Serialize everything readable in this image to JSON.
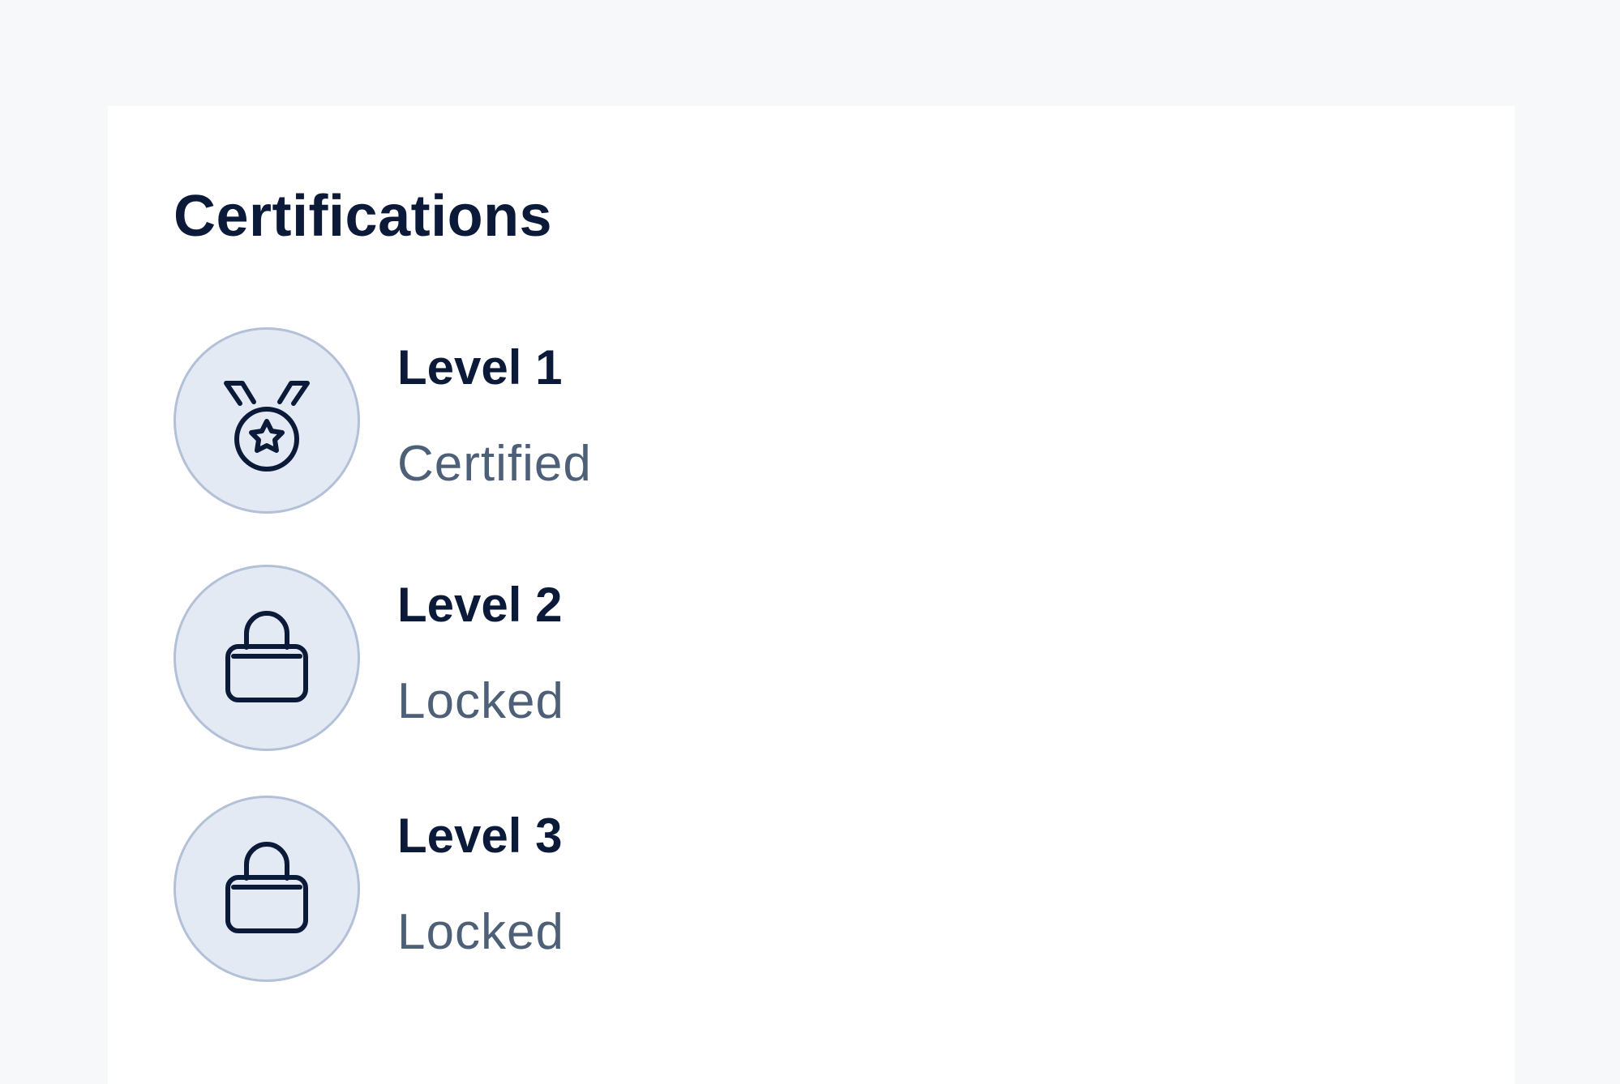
{
  "colors": {
    "page_background": "#f7f8fa",
    "card_background": "#ffffff",
    "title_text": "#0c1a3a",
    "status_text": "#4e5f78",
    "badge_fill": "#e3eaf3",
    "badge_border": "#b2c1d8",
    "icon_stroke": "#0c1a3a"
  },
  "certifications": {
    "title": "Certifications",
    "items": [
      {
        "name": "Level 1",
        "status": "Certified",
        "icon": "medal-icon"
      },
      {
        "name": "Level 2",
        "status": "Locked",
        "icon": "lock-icon"
      },
      {
        "name": "Level 3",
        "status": "Locked",
        "icon": "lock-icon"
      }
    ]
  }
}
